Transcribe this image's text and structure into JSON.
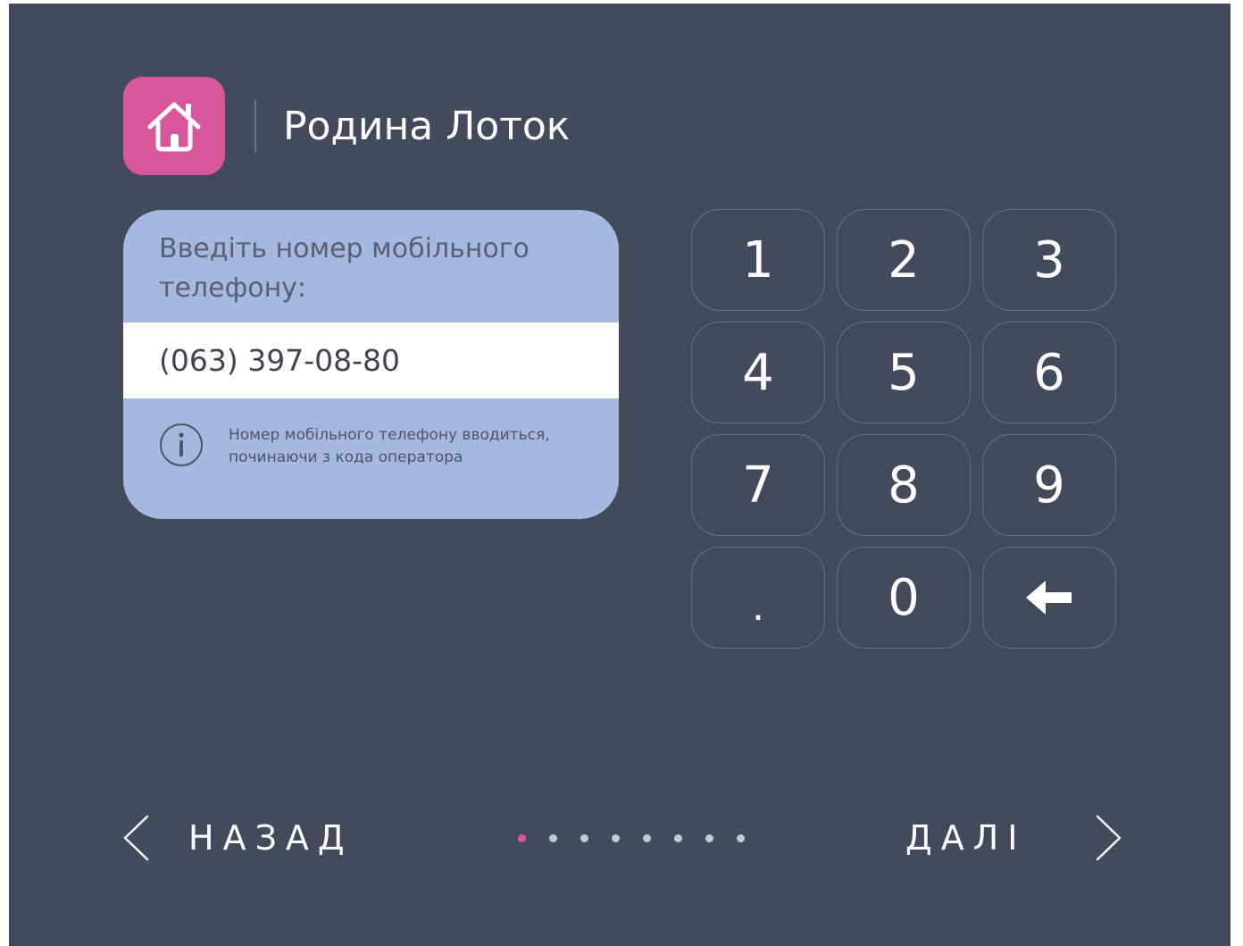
{
  "header": {
    "title": "Родина Лоток",
    "home_icon": "home-icon",
    "accent_color": "#d8579a"
  },
  "phone_card": {
    "prompt": "Введіть номер мобільного телефону:",
    "phone_value": "(063) 397-08-80",
    "info_icon": "info-icon",
    "info_text": "Номер мобільного телефону вводиться, починаючи з кода оператора"
  },
  "keypad": {
    "keys": [
      "1",
      "2",
      "3",
      "4",
      "5",
      "6",
      "7",
      "8",
      "9",
      ".",
      "0"
    ],
    "backspace_icon": "backspace-arrow-icon"
  },
  "footer": {
    "back_label": "НАЗАД",
    "next_label": "ДАЛІ",
    "step_current": 1,
    "step_total": 8
  },
  "colors": {
    "background": "#434a5c",
    "card": "#a4b8e0",
    "active_dot": "#d8579a",
    "inactive_dot": "#c4c8d2"
  }
}
